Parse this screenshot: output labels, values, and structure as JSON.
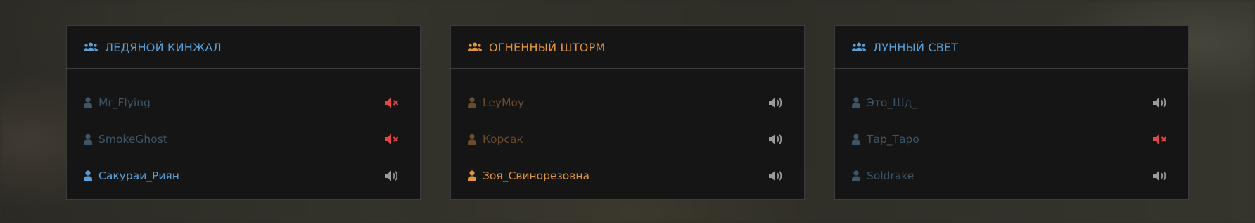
{
  "colors": {
    "blue_team": "#5aa0d8",
    "orange_team": "#e0963c",
    "muted_icon": "#9a9a9a",
    "unmuted_red": "#e04848"
  },
  "teams": [
    {
      "name": "ЛЕДЯНОЙ КИНЖАЛ",
      "color": "blue",
      "players": [
        {
          "name": "Mr_Flying",
          "active": false,
          "audio": "muted"
        },
        {
          "name": "SmokeGhost",
          "active": false,
          "audio": "muted"
        },
        {
          "name": "Сакураи_Риян",
          "active": true,
          "audio": "on"
        }
      ]
    },
    {
      "name": "ОГНЕННЫЙ ШТОРМ",
      "color": "orange",
      "players": [
        {
          "name": "LeyMoy",
          "active": false,
          "audio": "on"
        },
        {
          "name": "Корсак",
          "active": false,
          "audio": "on"
        },
        {
          "name": "Зоя_Свинорезовна",
          "active": true,
          "audio": "on"
        }
      ]
    },
    {
      "name": "ЛУННЫЙ СВЕТ",
      "color": "blue",
      "players": [
        {
          "name": "Это_Шд_",
          "active": false,
          "audio": "on"
        },
        {
          "name": "Тар_Таро",
          "active": false,
          "audio": "muted"
        },
        {
          "name": "Soldrake",
          "active": false,
          "audio": "on"
        }
      ]
    }
  ]
}
